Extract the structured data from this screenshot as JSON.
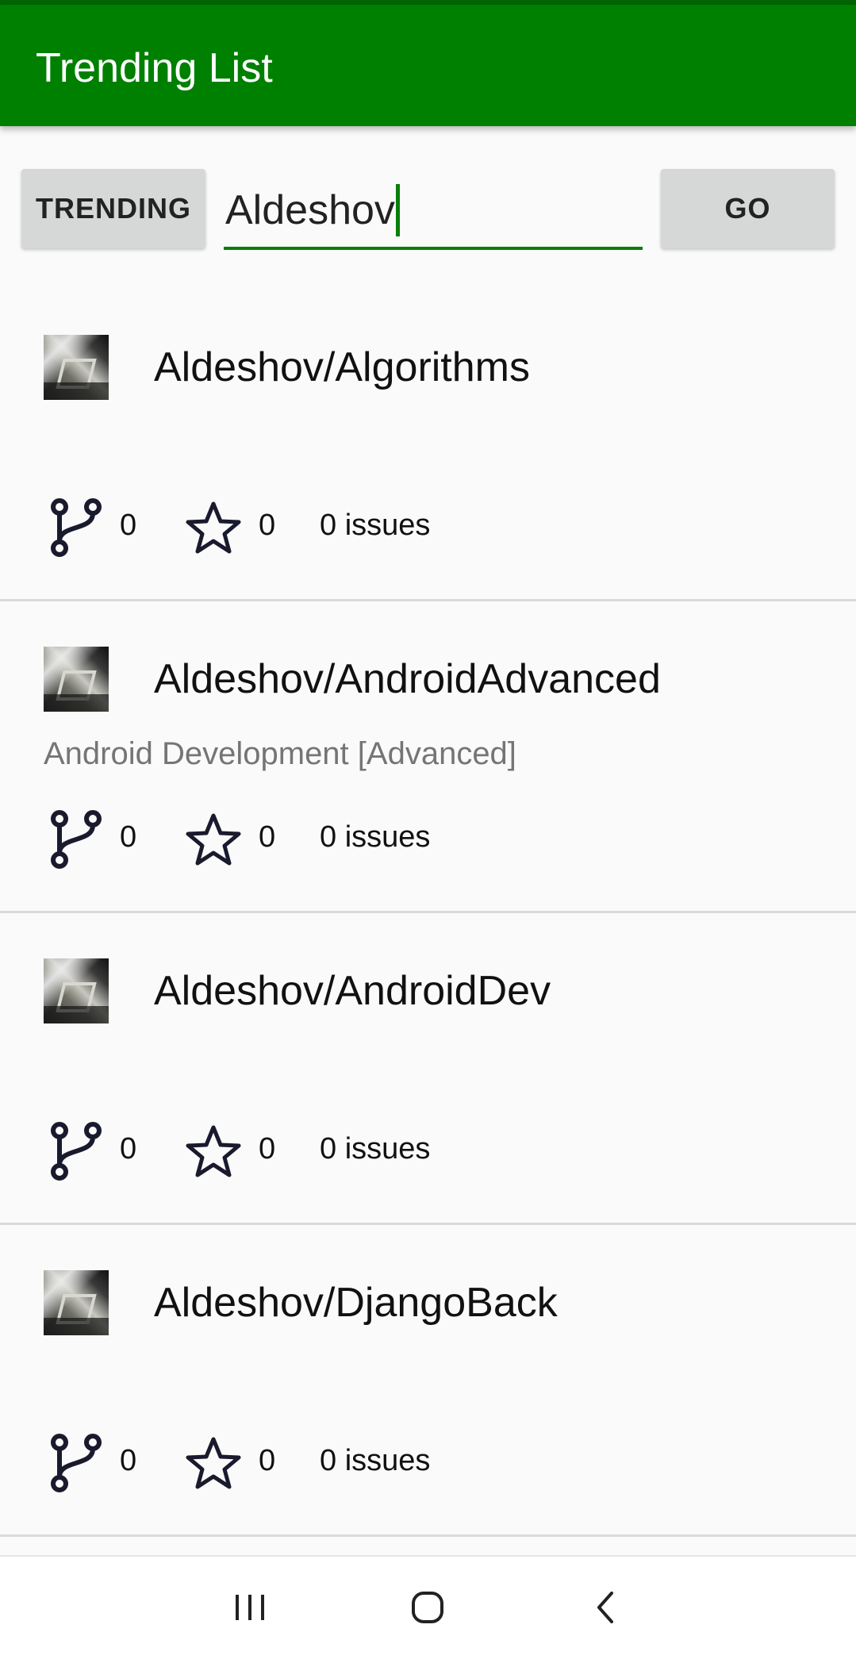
{
  "app_bar": {
    "title": "Trending List",
    "color": "#008000"
  },
  "controls": {
    "trending_label": "TRENDING",
    "search_value": "Aldeshov",
    "go_label": "GO"
  },
  "repos": [
    {
      "name": "Aldeshov/Algorithms",
      "description": "",
      "forks": "0",
      "stars": "0",
      "issues": "0 issues",
      "avatar_icon": "user-avatar"
    },
    {
      "name": "Aldeshov/AndroidAdvanced",
      "description": "Android Development [Advanced]",
      "forks": "0",
      "stars": "0",
      "issues": "0 issues",
      "avatar_icon": "user-avatar"
    },
    {
      "name": "Aldeshov/AndroidDev",
      "description": "",
      "forks": "0",
      "stars": "0",
      "issues": "0 issues",
      "avatar_icon": "user-avatar"
    },
    {
      "name": "Aldeshov/DjangoBack",
      "description": "",
      "forks": "0",
      "stars": "0",
      "issues": "0 issues",
      "avatar_icon": "user-avatar"
    }
  ],
  "icons": {
    "fork": "fork-icon",
    "star": "star-icon",
    "recents": "recents-icon",
    "home": "home-icon",
    "back": "back-icon"
  }
}
